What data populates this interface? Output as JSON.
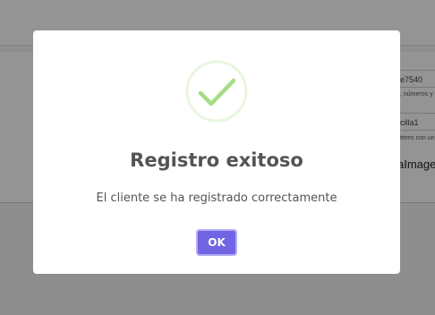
{
  "background": {
    "fields": [
      {
        "value": "e7540"
      },
      {
        "value": "cilla1"
      }
    ],
    "help_texts": [
      ", números y",
      "teres con un"
    ],
    "label": "aImagen"
  },
  "dialog": {
    "icon": "success-check-icon",
    "title": "Registro exitoso",
    "message": "El cliente se ha registrado correctamente",
    "ok_label": "OK",
    "colors": {
      "button": "#7265e3",
      "button_focus_ring": "#b3acf3",
      "check": "#a5dc86",
      "check_ring": "#e8f6de",
      "text": "#545454"
    }
  }
}
